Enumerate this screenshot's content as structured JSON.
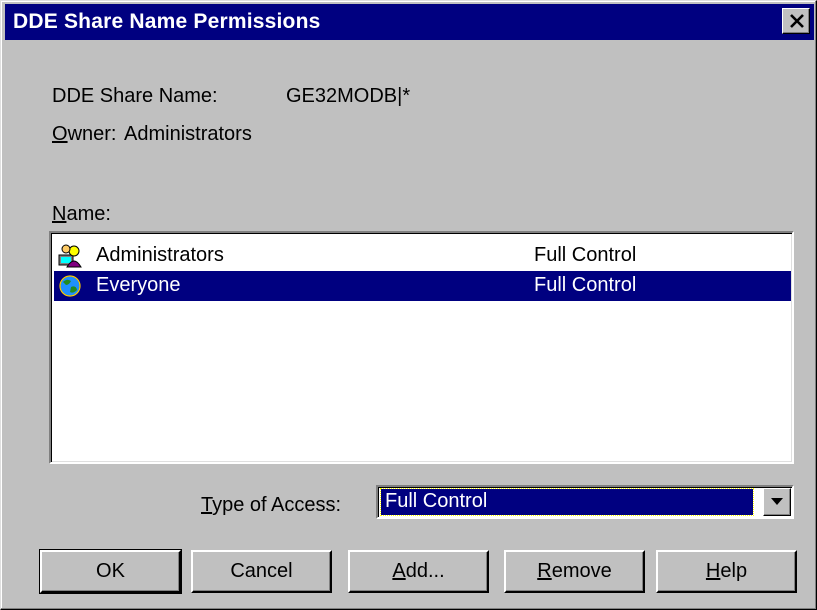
{
  "window": {
    "title": "DDE Share Name Permissions"
  },
  "info": {
    "share_name_label": "DDE Share Name:",
    "share_name_value": "GE32MODB|*",
    "owner_mnemonic": "O",
    "owner_label_rest": "wner:",
    "owner_value": "Administrators"
  },
  "list": {
    "label_mnemonic": "N",
    "label_rest": "ame:",
    "rows": [
      {
        "name": "Administrators",
        "permission": "Full Control",
        "icon": "user-group-icon",
        "selected": false
      },
      {
        "name": "Everyone",
        "permission": "Full Control",
        "icon": "globe-icon",
        "selected": true
      }
    ]
  },
  "access": {
    "label_mnemonic": "T",
    "label_rest": "ype of Access:",
    "value": "Full Control"
  },
  "buttons": {
    "ok": "OK",
    "cancel": "Cancel",
    "add_mnemonic": "A",
    "add_rest": "dd...",
    "remove_mnemonic": "R",
    "remove_rest": "emove",
    "help_mnemonic": "H",
    "help_rest": "elp"
  },
  "colors": {
    "face": "#c0c0c0",
    "titlebar": "#000080",
    "selection": "#000080"
  }
}
